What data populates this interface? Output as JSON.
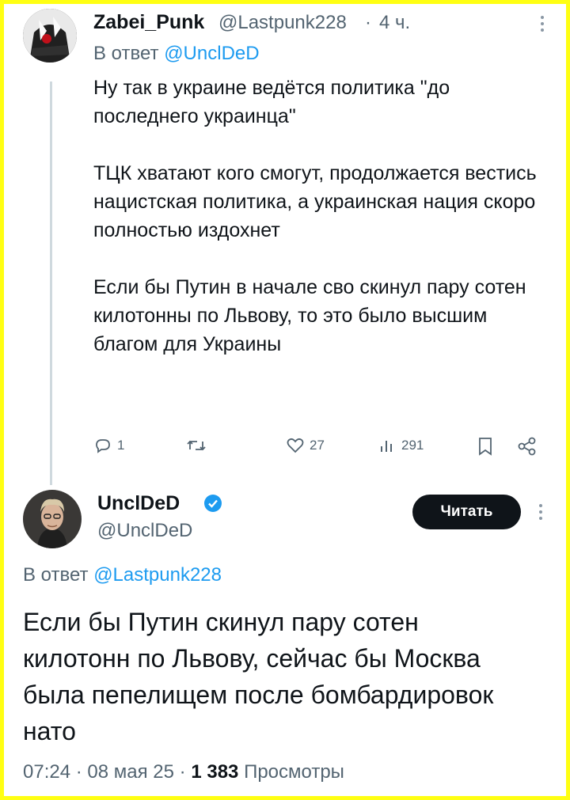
{
  "tweet1": {
    "display_name": "Zabei_Punk",
    "handle": "@Lastpunk228",
    "separator": "·",
    "time": "4 ч.",
    "reply_prefix": "В ответ",
    "reply_to": "@UnclDeD",
    "text": "Ну так в украине ведётся политика \"до последнего украинца\"\n\nТЦК хватают кого смогут, продолжается вестись нацистская политика, а украинская нация скоро полностью издохнет\n\nЕсли бы Путин в начале сво скинул пару сотен килотонны по Львову, то это было высшим благом для Украины",
    "actions": {
      "replies": "1",
      "retweets": "",
      "likes": "27",
      "views": "291"
    }
  },
  "tweet2": {
    "display_name": "UnclDeD",
    "handle": "@UnclDeD",
    "follow_label": "Читать",
    "reply_prefix": "В ответ",
    "reply_to": "@Lastpunk228",
    "text": "Если бы Путин скинул пару сотен килотонн по Львову, сейчас бы Москва была пепелищем после бомбардировок нато",
    "time": "07:24",
    "date": "08 мая 25",
    "views_count": "1 383",
    "views_label": "Просмотры",
    "separator": "·"
  },
  "colors": {
    "border": "#ffff12",
    "accent": "#1d9bf0",
    "secondary_text": "#536471",
    "primary_text": "#0f1419",
    "verified": "#1d9bf0"
  },
  "icons": [
    "reply-icon",
    "retweet-icon",
    "like-icon",
    "views-icon",
    "bookmark-icon",
    "share-icon",
    "more-icon",
    "verified-icon"
  ]
}
